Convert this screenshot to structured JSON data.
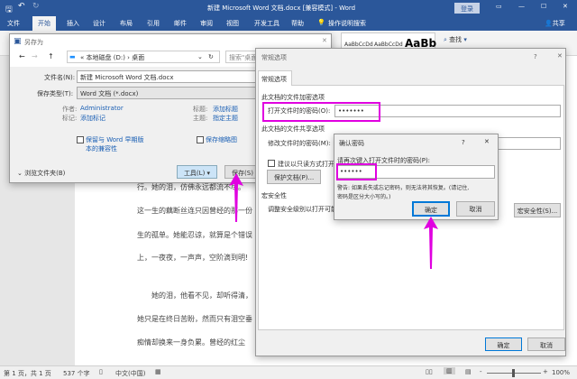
{
  "window": {
    "title": "新建 Microsoft Word 文档.docx [兼容模式] - Word",
    "login": "登录",
    "share": "共享"
  },
  "tabs": [
    "文件",
    "开始",
    "插入",
    "设计",
    "布局",
    "引用",
    "邮件",
    "审阅",
    "视图",
    "开发工具",
    "帮助"
  ],
  "tell_me": "操作说明搜索",
  "ribbon": {
    "styles": [
      "AaBbCcDd",
      "AaBbCcDd",
      "AaBb"
    ],
    "find": "查找"
  },
  "document": {
    "lines": [
      "行。她的泪，仿佛永远都流不尽。",
      "这一生的藕断丝连只因曾经的那一份",
      "生的孤单。她能忍谅，就算是个错误",
      "上，一夜夜，一声声，空阶滴到明!",
      "她的泪，他看不见，却听得清，",
      "她只是在终日苦盼，然而只有泪空垂",
      "痴情却换来一身负累。曾经的红尘"
    ]
  },
  "saveas": {
    "title": "另存为",
    "path": [
      "本地磁盘 (D:)",
      "桌面"
    ],
    "search_placeholder": "搜索\"桌面\"",
    "filename_label": "文件名(N):",
    "filename": "新建 Microsoft Word 文档.docx",
    "type_label": "保存类型(T):",
    "type": "Word 文档 (*.docx)",
    "author_label": "作者:",
    "author": "Administrator",
    "tags_label": "标记:",
    "tags": "添加标记",
    "title_label": "标题:",
    "title_val": "添加标题",
    "subject_label": "主题:",
    "subject": "指定主题",
    "compat_line1": "保留与 Word 早期版",
    "compat_line2": "本的兼容性",
    "thumb": "保存缩略图",
    "browse": "浏览文件夹(B)",
    "tools": "工具(L)",
    "save": "保存(S)"
  },
  "general": {
    "title": "常规选项",
    "tab": "常规选项",
    "enc_section": "此文档的文件加密选项",
    "open_pwd_label": "打开文件时的密码(O):",
    "open_pwd": "•••••••",
    "share_section": "此文档的文件共享选项",
    "modify_pwd_label": "修改文件时的密码(M):",
    "readonly": "建议以只读方式打开",
    "protect": "保护文档(P)...",
    "macro_section": "宏安全性",
    "macro_text": "调整安全级别以打开可能",
    "macro_btn": "宏安全性(S)...",
    "ok": "确定",
    "cancel": "取消"
  },
  "confirm": {
    "title": "确认密码",
    "prompt": "请再次键入打开文件时的密码(P):",
    "pwd": "••••••",
    "warn1": "警告: 如果丢失或忘记密码，则无法将其恢复。(请记住,",
    "warn2": "密码是区分大小写的。)",
    "ok": "确定",
    "cancel": "取消"
  },
  "status": {
    "page": "第 1 页，共 1 页",
    "words": "537 个字",
    "lang": "中文(中国)",
    "zoom": "100%"
  },
  "colors": {
    "accent": "#2b579a",
    "highlight": "#e000e0"
  }
}
